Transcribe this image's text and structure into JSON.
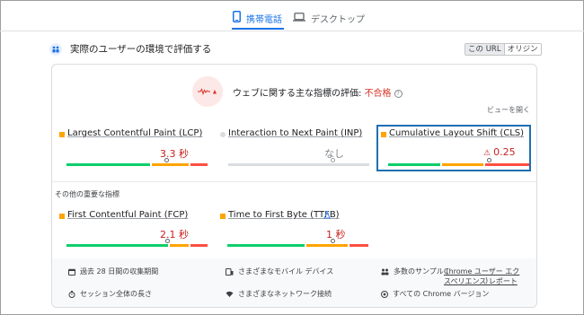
{
  "tabs": [
    {
      "label": "携帯電話",
      "icon": "phone-icon",
      "active": true
    },
    {
      "label": "デスクトップ",
      "icon": "laptop-icon",
      "active": false
    }
  ],
  "section": {
    "title": "実際のユーザーの環境で評価する",
    "icon": "users-icon",
    "toggle": {
      "options": [
        "この URL",
        "オリジン"
      ],
      "selected": "この URL"
    }
  },
  "assessment": {
    "prefix": "ウェブに関する主な指標の評価: ",
    "result": "不合格",
    "expand_label": "ビューを開く"
  },
  "core_metrics": [
    {
      "name": "Largest Contentful Paint (LCP)",
      "value": "3.3 秒",
      "status": "needs-improvement"
    },
    {
      "name": "Interaction to Next Paint (INP)",
      "value": "なし",
      "status": "no-data"
    },
    {
      "name": "Cumulative Layout Shift (CLS)",
      "value": "0.25",
      "status": "needs-improvement",
      "value_prefix": "⚠"
    }
  ],
  "other_title": "その他の重要な指標",
  "other_metrics": [
    {
      "name": "First Contentful Paint (FCP)",
      "value": "2.1 秒",
      "status": "needs-improvement"
    },
    {
      "name": "Time to First Byte (TTFB)",
      "value": "1 秒",
      "status": "needs-improvement",
      "experimental": true
    }
  ],
  "footer": {
    "period": "過去 28 日間の収集期間",
    "devices": "さまざまなモバイル デバイス",
    "samples_prefix": "多数のサンプル (",
    "samples_link": "Chrome ユーザー エクスペリエンス レポート",
    "samples_suffix": ")",
    "session": "セッション全体の長さ",
    "network": "さまざまなネットワーク接続",
    "versions": "すべての Chrome バージョン"
  },
  "colors": {
    "accent": "#1a73e8",
    "good": "#0cce6b",
    "needs_improvement": "#ffa400",
    "poor": "#ff4e42",
    "fail": "#d93025",
    "highlight": "#1f6fb2"
  }
}
